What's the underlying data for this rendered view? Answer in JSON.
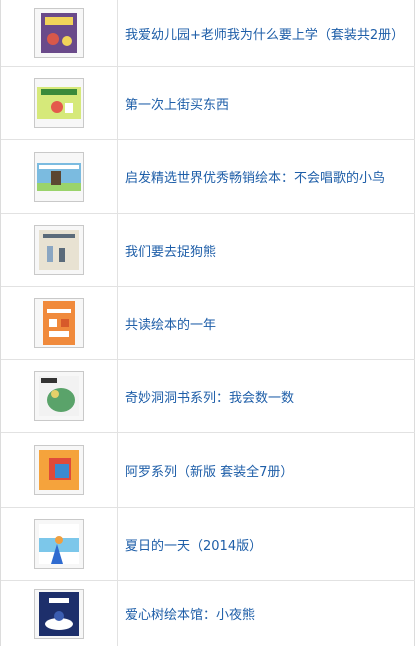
{
  "books": [
    {
      "title": "我爱幼儿园+老师我为什么要上学（套装共2册）",
      "cover": "cover-icon",
      "palette": [
        "#6a4a8a",
        "#d8584a",
        "#f1d35a"
      ]
    },
    {
      "title": "第一次上街买东西",
      "cover": "cover-icon",
      "palette": [
        "#d6e97a",
        "#e45a4c",
        "#3a8a3a"
      ]
    },
    {
      "title": "启发精选世界优秀畅销绘本：不会唱歌的小鸟",
      "cover": "cover-icon",
      "palette": [
        "#7bbbe0",
        "#5b4632",
        "#9ad36b"
      ]
    },
    {
      "title": "我们要去捉狗熊",
      "cover": "cover-icon",
      "palette": [
        "#e8e2d2",
        "#5b6b7a",
        "#8aa6c2"
      ]
    },
    {
      "title": "共读绘本的一年",
      "cover": "cover-icon",
      "palette": [
        "#f08a3c",
        "#ffffff",
        "#d75a2a"
      ]
    },
    {
      "title": "奇妙洞洞书系列：我会数一数",
      "cover": "cover-icon",
      "palette": [
        "#f2f2f2",
        "#5aa36a",
        "#e4d06a"
      ]
    },
    {
      "title": "阿罗系列（新版 套装全7册）",
      "cover": "cover-icon",
      "palette": [
        "#f5a33c",
        "#e04a3a",
        "#3a8ad0"
      ]
    },
    {
      "title": "夏日的一天（2014版）",
      "cover": "cover-icon",
      "palette": [
        "#7cc7ea",
        "#2f6bd0",
        "#ffffff"
      ]
    },
    {
      "title": "爱心树绘本馆：小夜熊",
      "cover": "cover-icon",
      "palette": [
        "#1d2f6b",
        "#ffffff",
        "#3b5db0"
      ]
    }
  ]
}
